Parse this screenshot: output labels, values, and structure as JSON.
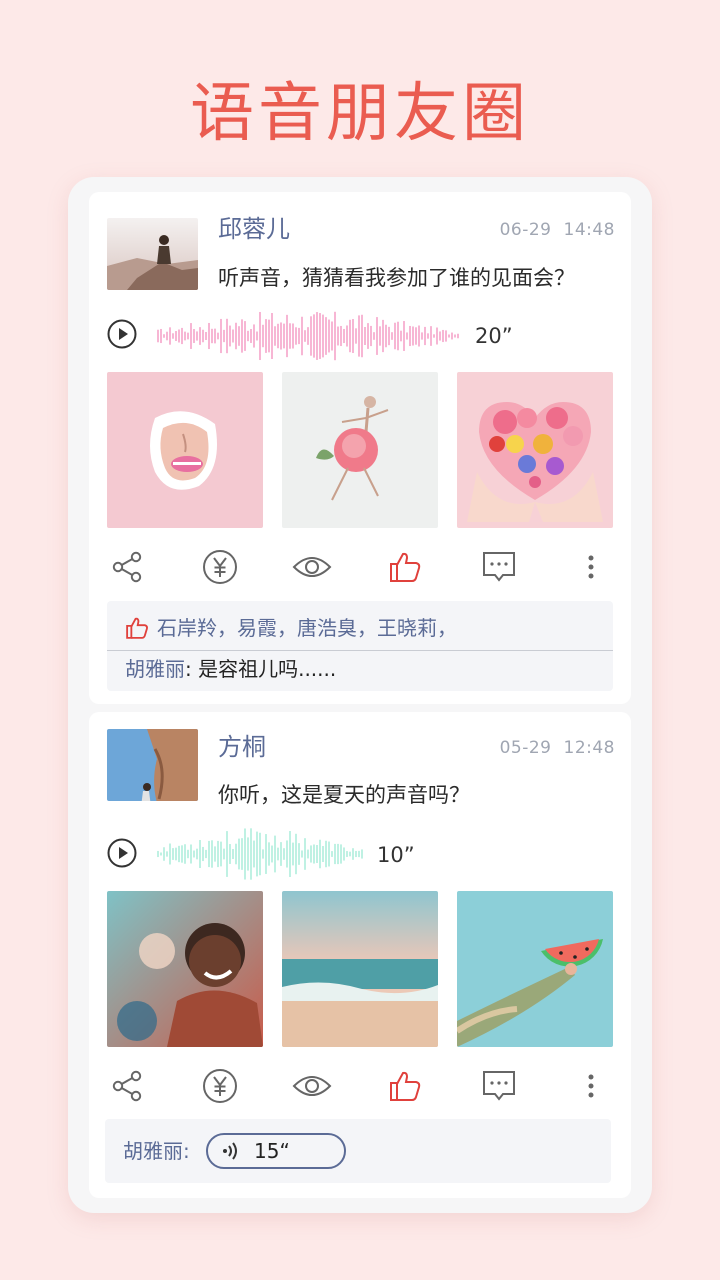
{
  "headline": "语音朋友圈",
  "posts": [
    {
      "name": "邱蓉儿",
      "date": "06-29",
      "time": "14:48",
      "text": "听声音，猜猜看我参加了谁的见面会？",
      "voice_duration": "20”",
      "wave_color": "#f7b6d4",
      "likes": "石岸羚，易霞，唐浩臭，王晓莉，",
      "comment_author": "胡雅丽",
      "comment_text": ": 是容祖儿吗......"
    },
    {
      "name": "方桐",
      "date": "05-29",
      "time": "12:48",
      "text": "你听，这是夏天的声音吗？",
      "voice_duration": "10”",
      "wave_color": "#bff1e3",
      "comment_author": "胡雅丽:",
      "voice_reply": "15“"
    }
  ],
  "colors": {
    "accent": "#ea5c50",
    "name": "#5b6b96",
    "like_active": "#e0413c",
    "icon": "#666666"
  }
}
